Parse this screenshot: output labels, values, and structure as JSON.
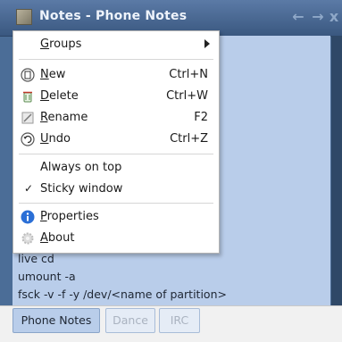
{
  "window": {
    "title": "Notes - Phone Notes",
    "controls": {
      "prev": "←",
      "next": "→",
      "close": "x"
    }
  },
  "note_content": [
    "live cd",
    "umount -a",
    "fsck -v -f -y /dev/<name of partition>"
  ],
  "menu": {
    "groups": {
      "mnemonic": "G",
      "rest": "roups"
    },
    "new": {
      "mnemonic": "N",
      "rest": "ew",
      "shortcut": "Ctrl+N"
    },
    "delete": {
      "mnemonic": "D",
      "rest": "elete",
      "shortcut": "Ctrl+W"
    },
    "rename": {
      "mnemonic": "R",
      "rest": "ename",
      "shortcut": "F2"
    },
    "undo": {
      "mnemonic": "U",
      "rest": "ndo",
      "shortcut": "Ctrl+Z"
    },
    "always_on_top": "Always on top",
    "sticky_window": "Sticky window",
    "sticky_check": "✓",
    "properties": {
      "mnemonic": "P",
      "rest": "roperties"
    },
    "about": {
      "mnemonic": "A",
      "rest": "bout"
    }
  },
  "tabs": [
    {
      "label": "Phone Notes",
      "active": true
    },
    {
      "label": "Dance",
      "active": false
    },
    {
      "label": "IRC",
      "active": false
    }
  ],
  "colors": {
    "titlebar": "#4b6d97",
    "content": "#b9cdea",
    "menu_bg": "#ffffff",
    "properties_icon": "#2b6fd6"
  }
}
